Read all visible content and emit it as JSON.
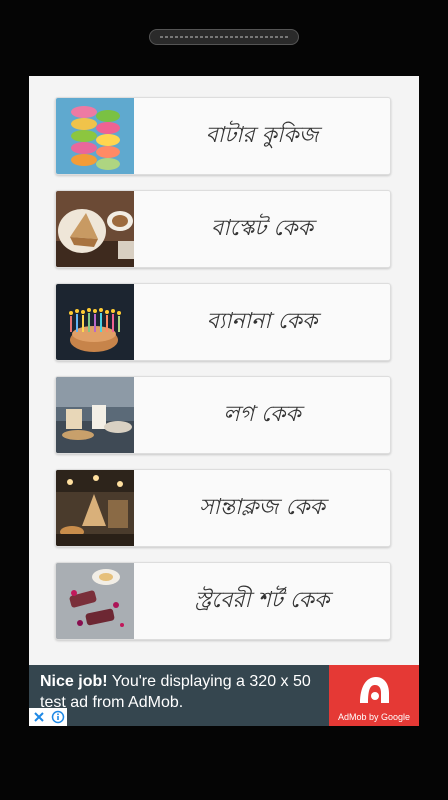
{
  "colors": {
    "screen_bg": "#f4f4f4",
    "card_bg": "#fafafa",
    "ad_bg": "#35464f",
    "admob_red": "#e53935"
  },
  "items": [
    {
      "label": "বাটার কুকিজ",
      "image": "macarons"
    },
    {
      "label": "বাস্কেট কেক",
      "image": "cake-slice-coffee"
    },
    {
      "label": "ব্যানানা কেক",
      "image": "birthday-candles"
    },
    {
      "label": "লগ কেক",
      "image": "cafe-table"
    },
    {
      "label": "সান্তাক্লজ কেক",
      "image": "pastry-shop"
    },
    {
      "label": "স্ট্রবেরী শর্ট কেক",
      "image": "berry-dessert"
    }
  ],
  "ad": {
    "headline": "Nice job!",
    "body": " You're displaying a 320 x 50 test ad from AdMob.",
    "brand": "AdMob by Google"
  }
}
